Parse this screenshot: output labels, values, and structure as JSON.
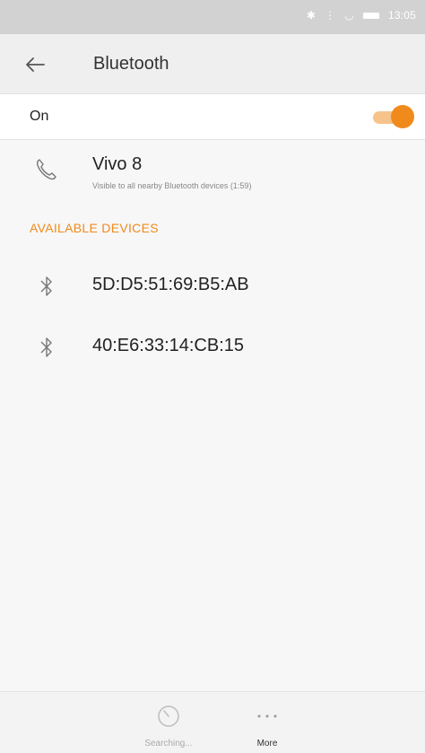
{
  "status_bar": {
    "time": "13:05",
    "icons": [
      "bluetooth-icon",
      "vibrate-icon",
      "wifi-icon",
      "battery-icon"
    ]
  },
  "header": {
    "title": "Bluetooth",
    "back_icon": "arrow-left-icon"
  },
  "toggle": {
    "label": "On",
    "state": true,
    "accent": "#f08a1c"
  },
  "paired_device": {
    "icon": "phone-icon",
    "name": "Vivo 8",
    "subtitle": "Visible to all nearby Bluetooth devices (1:59)"
  },
  "available_devices": {
    "header": "AVAILABLE DEVICES",
    "items": [
      {
        "icon": "bluetooth-icon",
        "name": "5D:D5:51:69:B5:AB"
      },
      {
        "icon": "bluetooth-icon",
        "name": "40:E6:33:14:CB:15"
      }
    ]
  },
  "bottom_bar": {
    "searching_label": "Searching...",
    "more_label": "More",
    "more_icon": "more-dots-icon",
    "searching_icon": "searching-spinner-icon"
  }
}
